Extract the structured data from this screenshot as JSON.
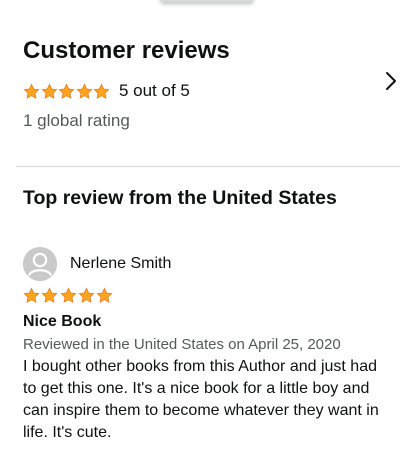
{
  "customer_reviews": {
    "title": "Customer reviews",
    "rating_text": "5 out of 5",
    "rating_value": 5,
    "rating_max": 5,
    "global_rating": "1 global rating"
  },
  "top_review": {
    "section_title": "Top review from the United States",
    "reviewer_name": "Nerlene Smith",
    "stars": 5,
    "title": "Nice Book",
    "meta": "Reviewed in the United States on April 25, 2020",
    "body": "I bought other books from this Author and just had to get this one. It's a nice book for a little boy and can inspire them to become whatever they want in life. It's cute."
  },
  "icons": {
    "star": "star-icon",
    "chevron": "chevron-right-icon",
    "avatar": "user-avatar-icon"
  },
  "colors": {
    "star_fill": "#ffa41c",
    "star_stroke": "#de7921",
    "secondary_text": "#565959",
    "divider": "#d5d9d9"
  }
}
